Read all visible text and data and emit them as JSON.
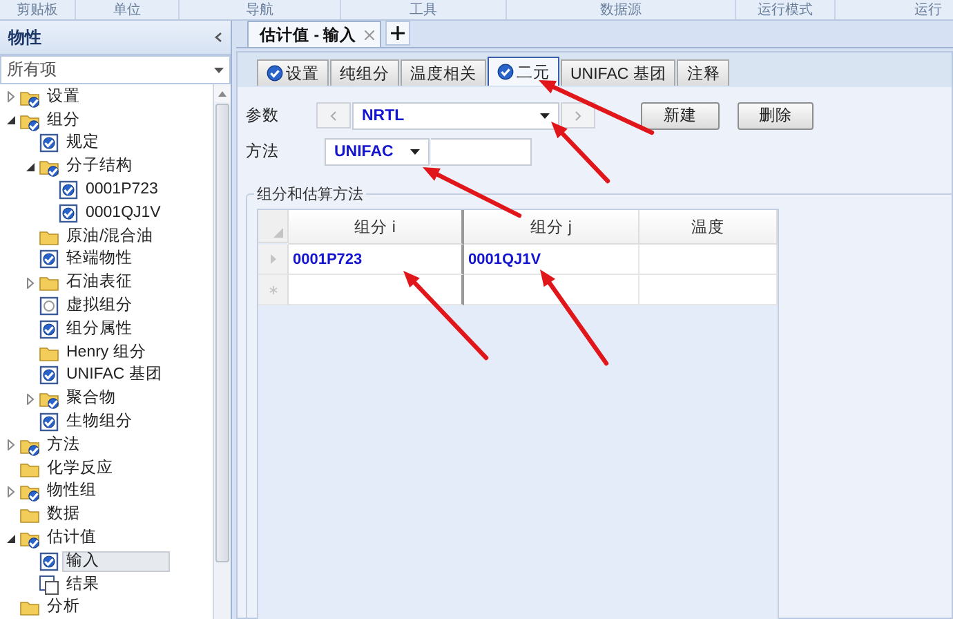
{
  "ribbon_groups": [
    "剪贴板",
    "单位",
    "导航",
    "工具",
    "数据源",
    "运行模式",
    "运行"
  ],
  "sidebar": {
    "title": "物性",
    "filter": {
      "value": "所有项"
    },
    "tree": [
      {
        "label": "设置",
        "kind": "folder-check",
        "expanded": false,
        "selected": false
      },
      {
        "label": "组分",
        "kind": "folder-check",
        "expanded": true,
        "selected": false,
        "children": [
          {
            "label": "规定",
            "kind": "form-check",
            "selected": false
          },
          {
            "label": "分子结构",
            "kind": "folder-check",
            "expanded": true,
            "selected": false,
            "children": [
              {
                "label": "0001P723",
                "kind": "form-check",
                "selected": false
              },
              {
                "label": "0001QJ1V",
                "kind": "form-check",
                "selected": false
              }
            ]
          },
          {
            "label": "原油/混合油",
            "kind": "folder",
            "selected": false
          },
          {
            "label": "轻端物性",
            "kind": "form-check",
            "selected": false
          },
          {
            "label": "石油表征",
            "kind": "folder",
            "expanded": false,
            "selected": false
          },
          {
            "label": "虚拟组分",
            "kind": "form-empty",
            "selected": false
          },
          {
            "label": "组分属性",
            "kind": "form-check",
            "selected": false
          },
          {
            "label": "Henry 组分",
            "kind": "folder",
            "selected": false
          },
          {
            "label": "UNIFAC 基团",
            "kind": "form-check",
            "selected": false
          },
          {
            "label": "聚合物",
            "kind": "folder-check",
            "expanded": false,
            "selected": false
          },
          {
            "label": "生物组分",
            "kind": "form-check",
            "selected": false
          }
        ]
      },
      {
        "label": "方法",
        "kind": "folder-check",
        "expanded": false,
        "selected": false
      },
      {
        "label": "化学反应",
        "kind": "folder",
        "selected": false
      },
      {
        "label": "物性组",
        "kind": "folder-check",
        "expanded": false,
        "selected": false
      },
      {
        "label": "数据",
        "kind": "folder",
        "selected": false
      },
      {
        "label": "估计值",
        "kind": "folder-check",
        "expanded": true,
        "selected": false,
        "children": [
          {
            "label": "输入",
            "kind": "form-check",
            "selected": true
          },
          {
            "label": "结果",
            "kind": "form-result",
            "selected": false
          }
        ]
      },
      {
        "label": "分析",
        "kind": "folder",
        "selected": false
      }
    ]
  },
  "document_tab": {
    "label": "估计值 - 输入"
  },
  "tabs": [
    {
      "label": "设置",
      "checked": true,
      "selected": false
    },
    {
      "label": "纯组分",
      "checked": false,
      "selected": false
    },
    {
      "label": "温度相关",
      "checked": false,
      "selected": false
    },
    {
      "label": "二元",
      "checked": true,
      "selected": true
    },
    {
      "label": "UNIFAC 基团",
      "checked": false,
      "selected": false
    },
    {
      "label": "注释",
      "checked": false,
      "selected": false
    }
  ],
  "parameter": {
    "label": "参数",
    "value": "NRTL"
  },
  "buttons": [
    "新建",
    "删除"
  ],
  "method": {
    "label": "方法",
    "value": "UNIFAC"
  },
  "group": {
    "title": "组分和估算方法",
    "columns": [
      "组分 i",
      "组分 j",
      "温度"
    ],
    "rows": [
      {
        "component_i": "0001P723",
        "component_j": "0001QJ1V"
      }
    ]
  }
}
